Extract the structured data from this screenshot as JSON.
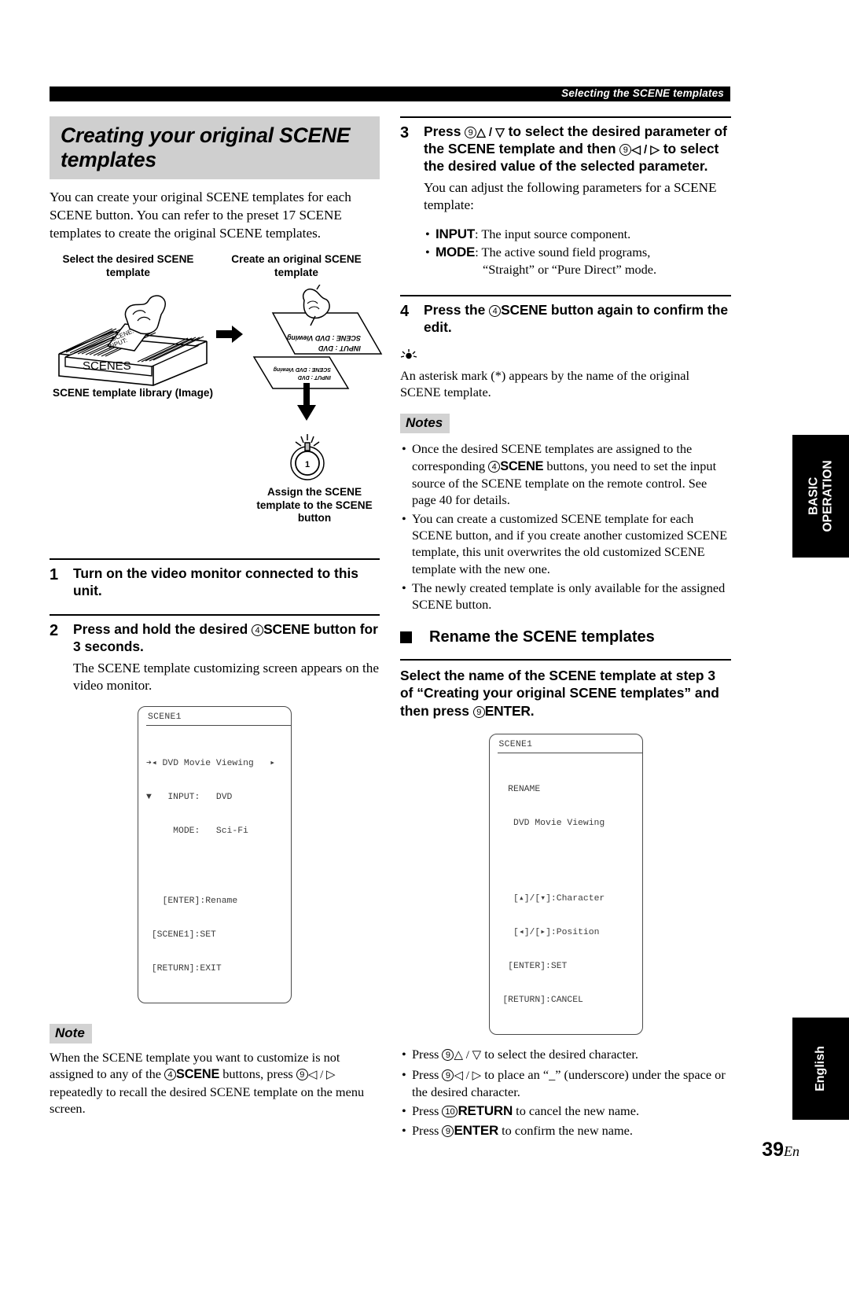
{
  "header": {
    "running_title": "Selecting the SCENE templates"
  },
  "left": {
    "section_title": "Creating your original SCENE templates",
    "intro": "You can create your original SCENE templates for each SCENE button. You can refer to the preset 17 SCENE templates to create the original SCENE templates.",
    "diagram": {
      "label_select": "Select the desired SCENE template",
      "label_create": "Create an original SCENE template",
      "label_library": "SCENE template library (Image)",
      "label_assign": "Assign the SCENE template to the SCENE button",
      "box_label": "SCENES",
      "card_line1": "SCENE:",
      "card_line2": "INPUT:",
      "sheet_line1": "SCENE : DVD Viewing",
      "sheet_line2": "INPUT : DVD",
      "button_number": "1"
    },
    "steps": [
      {
        "num": "1",
        "text": "Turn on the video monitor connected to this unit.",
        "body": ""
      },
      {
        "num": "2",
        "text_pre": "Press and hold the desired ",
        "text_cnum": "4",
        "text_kb": "SCENE",
        "text_post": " button for 3 seconds.",
        "body": "The SCENE template customizing screen appears on the video monitor."
      }
    ],
    "osd": {
      "title": "SCENE1",
      "line1": "➔◂ DVD Movie Viewing   ▸",
      "line2": "▼   INPUT:   DVD",
      "line3": "     MODE:   Sci-Fi",
      "line4": "   [ENTER]:Rename",
      "line5": " [SCENE1]:SET",
      "line6": " [RETURN]:EXIT"
    },
    "note": {
      "tag": "Note",
      "pre": "When the SCENE template you want to customize is not assigned to any of the ",
      "cnum": "4",
      "kb": "SCENE",
      "mid": " buttons, press ",
      "cnum2": "9",
      "arrows": "◁ / ▷",
      "post": " repeatedly to recall the desired SCENE template on the menu screen."
    }
  },
  "right": {
    "step3": {
      "num": "3",
      "t1": "Press ",
      "c1": "9",
      "a1": "△ / ▽",
      "t2": " to select the desired parameter of the SCENE template and then ",
      "c2": "9",
      "a2": "◁ / ▷",
      "t3": " to select the desired value of the selected parameter.",
      "body": "You can adjust the following parameters for a SCENE template:",
      "params": [
        {
          "name": "INPUT",
          "desc": ": The input source component."
        },
        {
          "name": "MODE",
          "desc": ": The active sound field programs,"
        }
      ],
      "param_cont": "“Straight” or “Pure Direct” mode."
    },
    "step4": {
      "num": "4",
      "t1": "Press the ",
      "c1": "4",
      "kb": "SCENE",
      "t2": " button again to confirm the edit."
    },
    "tip": {
      "icon": "tip-bulb",
      "text": "An asterisk mark (*) appears by the name of the original SCENE template."
    },
    "notes": {
      "tag": "Notes",
      "items": [
        {
          "pre": "Once the desired SCENE templates are assigned to the corresponding ",
          "cnum": "4",
          "kb": "SCENE",
          "post": " buttons, you need to set the input source of the SCENE template on the remote control. See page 40 for details."
        },
        {
          "pre": "You can create a customized SCENE template for each SCENE button, and if you create another customized SCENE template, this unit overwrites the old customized SCENE template with the new one.",
          "cnum": "",
          "kb": "",
          "post": ""
        },
        {
          "pre": "The newly created template is only available for the assigned SCENE button.",
          "cnum": "",
          "kb": "",
          "post": ""
        }
      ]
    },
    "rename": {
      "heading": "Rename the SCENE templates",
      "lead_t1": "Select the name of the SCENE template at step 3 of “Creating your original SCENE templates” and then press ",
      "lead_c1": "9",
      "lead_kb": "ENTER.",
      "osd": {
        "title": "SCENE1",
        "line1": "  RENAME",
        "line2": "   DVD Movie Viewing",
        "line3": "   [▴]/[▾]:Character",
        "line4": "   [◂]/[▸]:Position",
        "line5": "  [ENTER]:SET",
        "line6": " [RETURN]:CANCEL"
      },
      "bullets": [
        {
          "t1": "Press ",
          "c1": "9",
          "a1": "△ / ▽",
          "t2": " to select the desired character.",
          "kb": "",
          "t3": ""
        },
        {
          "t1": "Press ",
          "c1": "9",
          "a1": "◁ / ▷",
          "t2": " to place an “_” (underscore) under the space or the desired character.",
          "kb": "",
          "t3": ""
        },
        {
          "t1": "Press ",
          "c1": "10",
          "a1": "",
          "t2": "",
          "kb": "RETURN",
          "t3": " to cancel the new name."
        },
        {
          "t1": "Press ",
          "c1": "9",
          "a1": "",
          "t2": "",
          "kb": "ENTER",
          "t3": " to confirm the new name."
        }
      ]
    }
  },
  "tabs": {
    "basic_operation": "BASIC OPERATION",
    "english": "English"
  },
  "folio": {
    "page": "39",
    "lang": "En"
  }
}
